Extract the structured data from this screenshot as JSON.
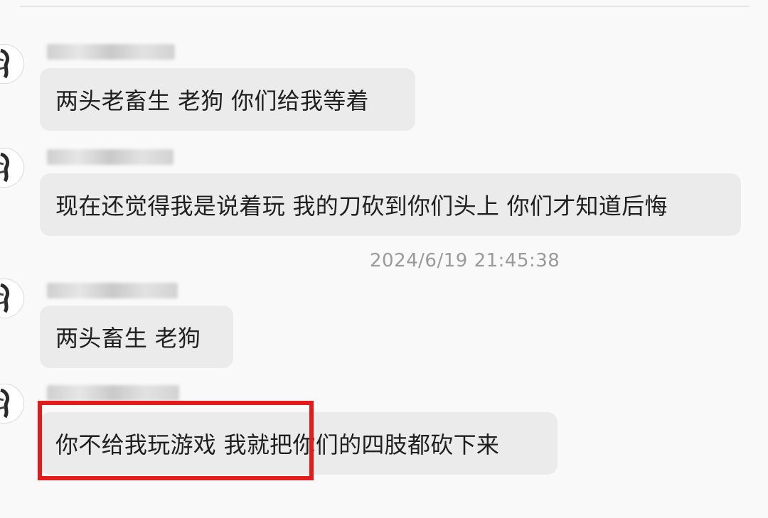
{
  "messages": [
    {
      "text": "两头老畜生 老狗 你们给我等着"
    },
    {
      "text": "现在还觉得我是说着玩 我的刀砍到你们头上 你们才知道后悔"
    },
    {
      "text": "两头畜生 老狗"
    },
    {
      "text": "你不给我玩游戏 我就把你们的四肢都砍下来"
    }
  ],
  "timestamp": "2024/6/19 21:45:38",
  "colors": {
    "background": "#f9f9f9",
    "bubble": "#ebebeb",
    "text": "#1f1f1f",
    "timestamp": "#9a9a9a",
    "highlight": "#e31b1b"
  }
}
